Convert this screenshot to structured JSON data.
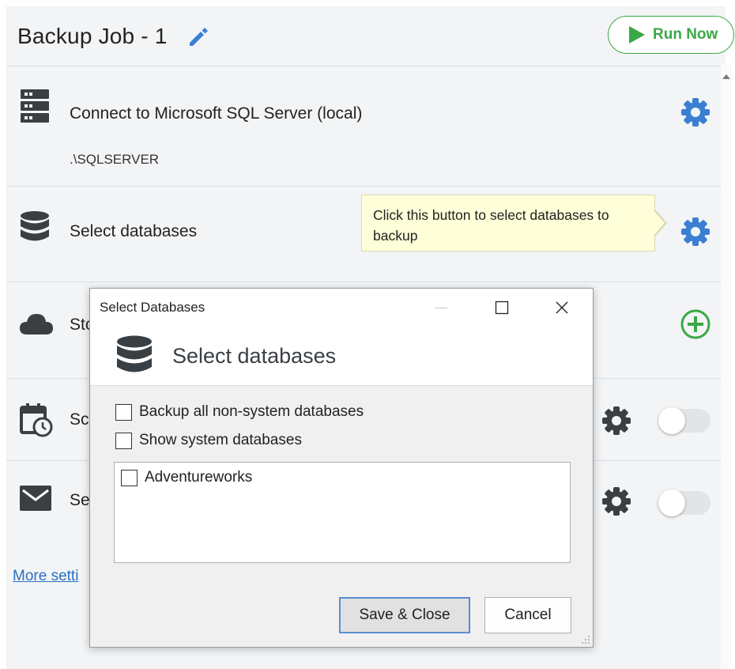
{
  "header": {
    "job_title": "Backup Job - 1",
    "run_now_label": "Run Now"
  },
  "rows": {
    "connect": {
      "label": "Connect to Microsoft SQL Server (local)",
      "server": ".\\SQLSERVER"
    },
    "select_db": {
      "label": "Select databases"
    },
    "storage": {
      "label_partial": "Sto"
    },
    "schedule": {
      "label_partial": "Sch"
    },
    "send": {
      "label_partial": "Se"
    }
  },
  "tooltip": {
    "text": "Click this button to select databases to backup"
  },
  "more_settings": {
    "label": "More setti"
  },
  "dialog": {
    "window_title": "Select Databases",
    "heading": "Select databases",
    "options": [
      {
        "label": "Backup all non-system databases",
        "checked": false
      },
      {
        "label": "Show system databases",
        "checked": false
      }
    ],
    "databases": [
      {
        "label": "Adventureworks",
        "checked": false
      }
    ],
    "save_close_label": "Save & Close",
    "cancel_label": "Cancel"
  },
  "colors": {
    "accent_blue": "#3b7fd4",
    "run_green": "#3aa845",
    "icon_dark": "#3a3f44",
    "toggle_off": "#e2e4e6",
    "tooltip_bg": "#fefed9"
  },
  "icons": {
    "edit": "pencil-icon",
    "run": "play-icon",
    "server": "server-icon",
    "database": "database-icon",
    "storage": "cloud-icon",
    "schedule": "calendar-clock-icon",
    "notification": "envelope-icon",
    "settings": "gear-icon",
    "add": "plus-circle-icon"
  }
}
